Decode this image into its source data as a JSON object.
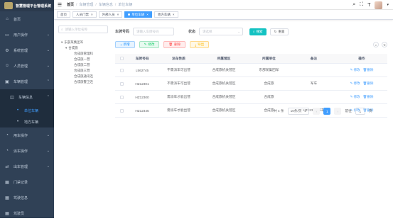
{
  "app": {
    "title": "智慧管理平台管理系统"
  },
  "sidebar": {
    "items": [
      {
        "label": "首页",
        "icon": "home-icon"
      },
      {
        "label": "用户操作",
        "icon": "monitor-icon"
      },
      {
        "label": "系统管理",
        "icon": "settings-icon"
      },
      {
        "label": "人员管理",
        "icon": "user-icon"
      },
      {
        "label": "车辆管理",
        "icon": "car-icon"
      }
    ],
    "sub_parent": {
      "label": "车辆信息",
      "icon": "info-icon"
    },
    "sub_items": [
      {
        "label": "单位车辆"
      },
      {
        "label": "地方车辆"
      }
    ],
    "more": [
      {
        "label": "用车操作",
        "icon": "dashboard-icon"
      },
      {
        "label": "派车操作",
        "icon": "dashboard-icon"
      },
      {
        "label": "出车管理",
        "icon": "swap-icon"
      },
      {
        "label": "门禁记录",
        "icon": "grid-icon"
      },
      {
        "label": "驾驶信息",
        "icon": "grid-icon"
      },
      {
        "label": "驾驶员",
        "icon": "grid-icon"
      }
    ]
  },
  "header": {
    "breadcrumb": [
      "首页",
      "车辆管理",
      "车辆信息",
      "单位车辆"
    ]
  },
  "tags": [
    {
      "label": "首页",
      "active": false,
      "closable": false
    },
    {
      "label": "人员门禁",
      "active": false,
      "closable": true
    },
    {
      "label": "外部人员",
      "active": false,
      "closable": true
    },
    {
      "label": "单位车辆",
      "active": true,
      "closable": true
    },
    {
      "label": "地方车辆",
      "active": false,
      "closable": true
    }
  ],
  "tree": {
    "search_placeholder": "请输入单位名称",
    "nodes": [
      {
        "label": "东部某集团军",
        "level": 0,
        "arrow": "▾"
      },
      {
        "label": "合成旅",
        "level": 1,
        "arrow": "▾"
      },
      {
        "label": "合成旅管理科",
        "level": 2,
        "arrow": ""
      },
      {
        "label": "合成旅一营",
        "level": 2,
        "arrow": ""
      },
      {
        "label": "合成旅二营",
        "level": 2,
        "arrow": ""
      },
      {
        "label": "合成旅三营",
        "level": 2,
        "arrow": ""
      },
      {
        "label": "合成旅通讯连",
        "level": 2,
        "arrow": ""
      },
      {
        "label": "合成旅警卫连",
        "level": 2,
        "arrow": ""
      }
    ]
  },
  "search": {
    "plate_label": "车牌号码",
    "plate_placeholder": "请输入车牌号码",
    "status_label": "状态",
    "status_placeholder": "请选择",
    "search_btn": "搜索",
    "reset_btn": "重置"
  },
  "toolbar": {
    "add": "新增",
    "edit": "修改",
    "delete": "删除",
    "export": "导出"
  },
  "table": {
    "headers": [
      "车牌号码",
      "派车性质",
      "所属营区",
      "所属单位",
      "备注",
      "操作"
    ],
    "rows": [
      {
        "plate": "L562745",
        "nature": "不需派车可出营",
        "area": "合成旅机关营区",
        "unit": "东部某集团军",
        "note": "",
        "edit": "修改",
        "delete": "删除"
      },
      {
        "plate": "HZ12301",
        "nature": "不需派车可出营",
        "area": "合成旅机关营区",
        "unit": "合成旅",
        "note": "军车",
        "edit": "修改",
        "delete": "删除"
      },
      {
        "plate": "HZ12300",
        "nature": "需派车才能出营",
        "area": "合成旅机关营区",
        "unit": "合成旅",
        "note": "",
        "edit": "修改",
        "delete": "删除"
      },
      {
        "plate": "HZ12345",
        "nature": "需派车才能出营",
        "area": "合成旅机关营区",
        "unit": "合成旅",
        "note": "HZ12345-军车",
        "edit": "修改",
        "delete": "删除"
      }
    ]
  },
  "pagination": {
    "total": "共 4 条",
    "page_size": "10条/页",
    "current": "1",
    "goto_label": "前往",
    "goto_value": "1",
    "page_suffix": "页"
  },
  "colors": {
    "accent": "#409eff",
    "sidebar": "#304156",
    "teal": "#13c2c2"
  }
}
